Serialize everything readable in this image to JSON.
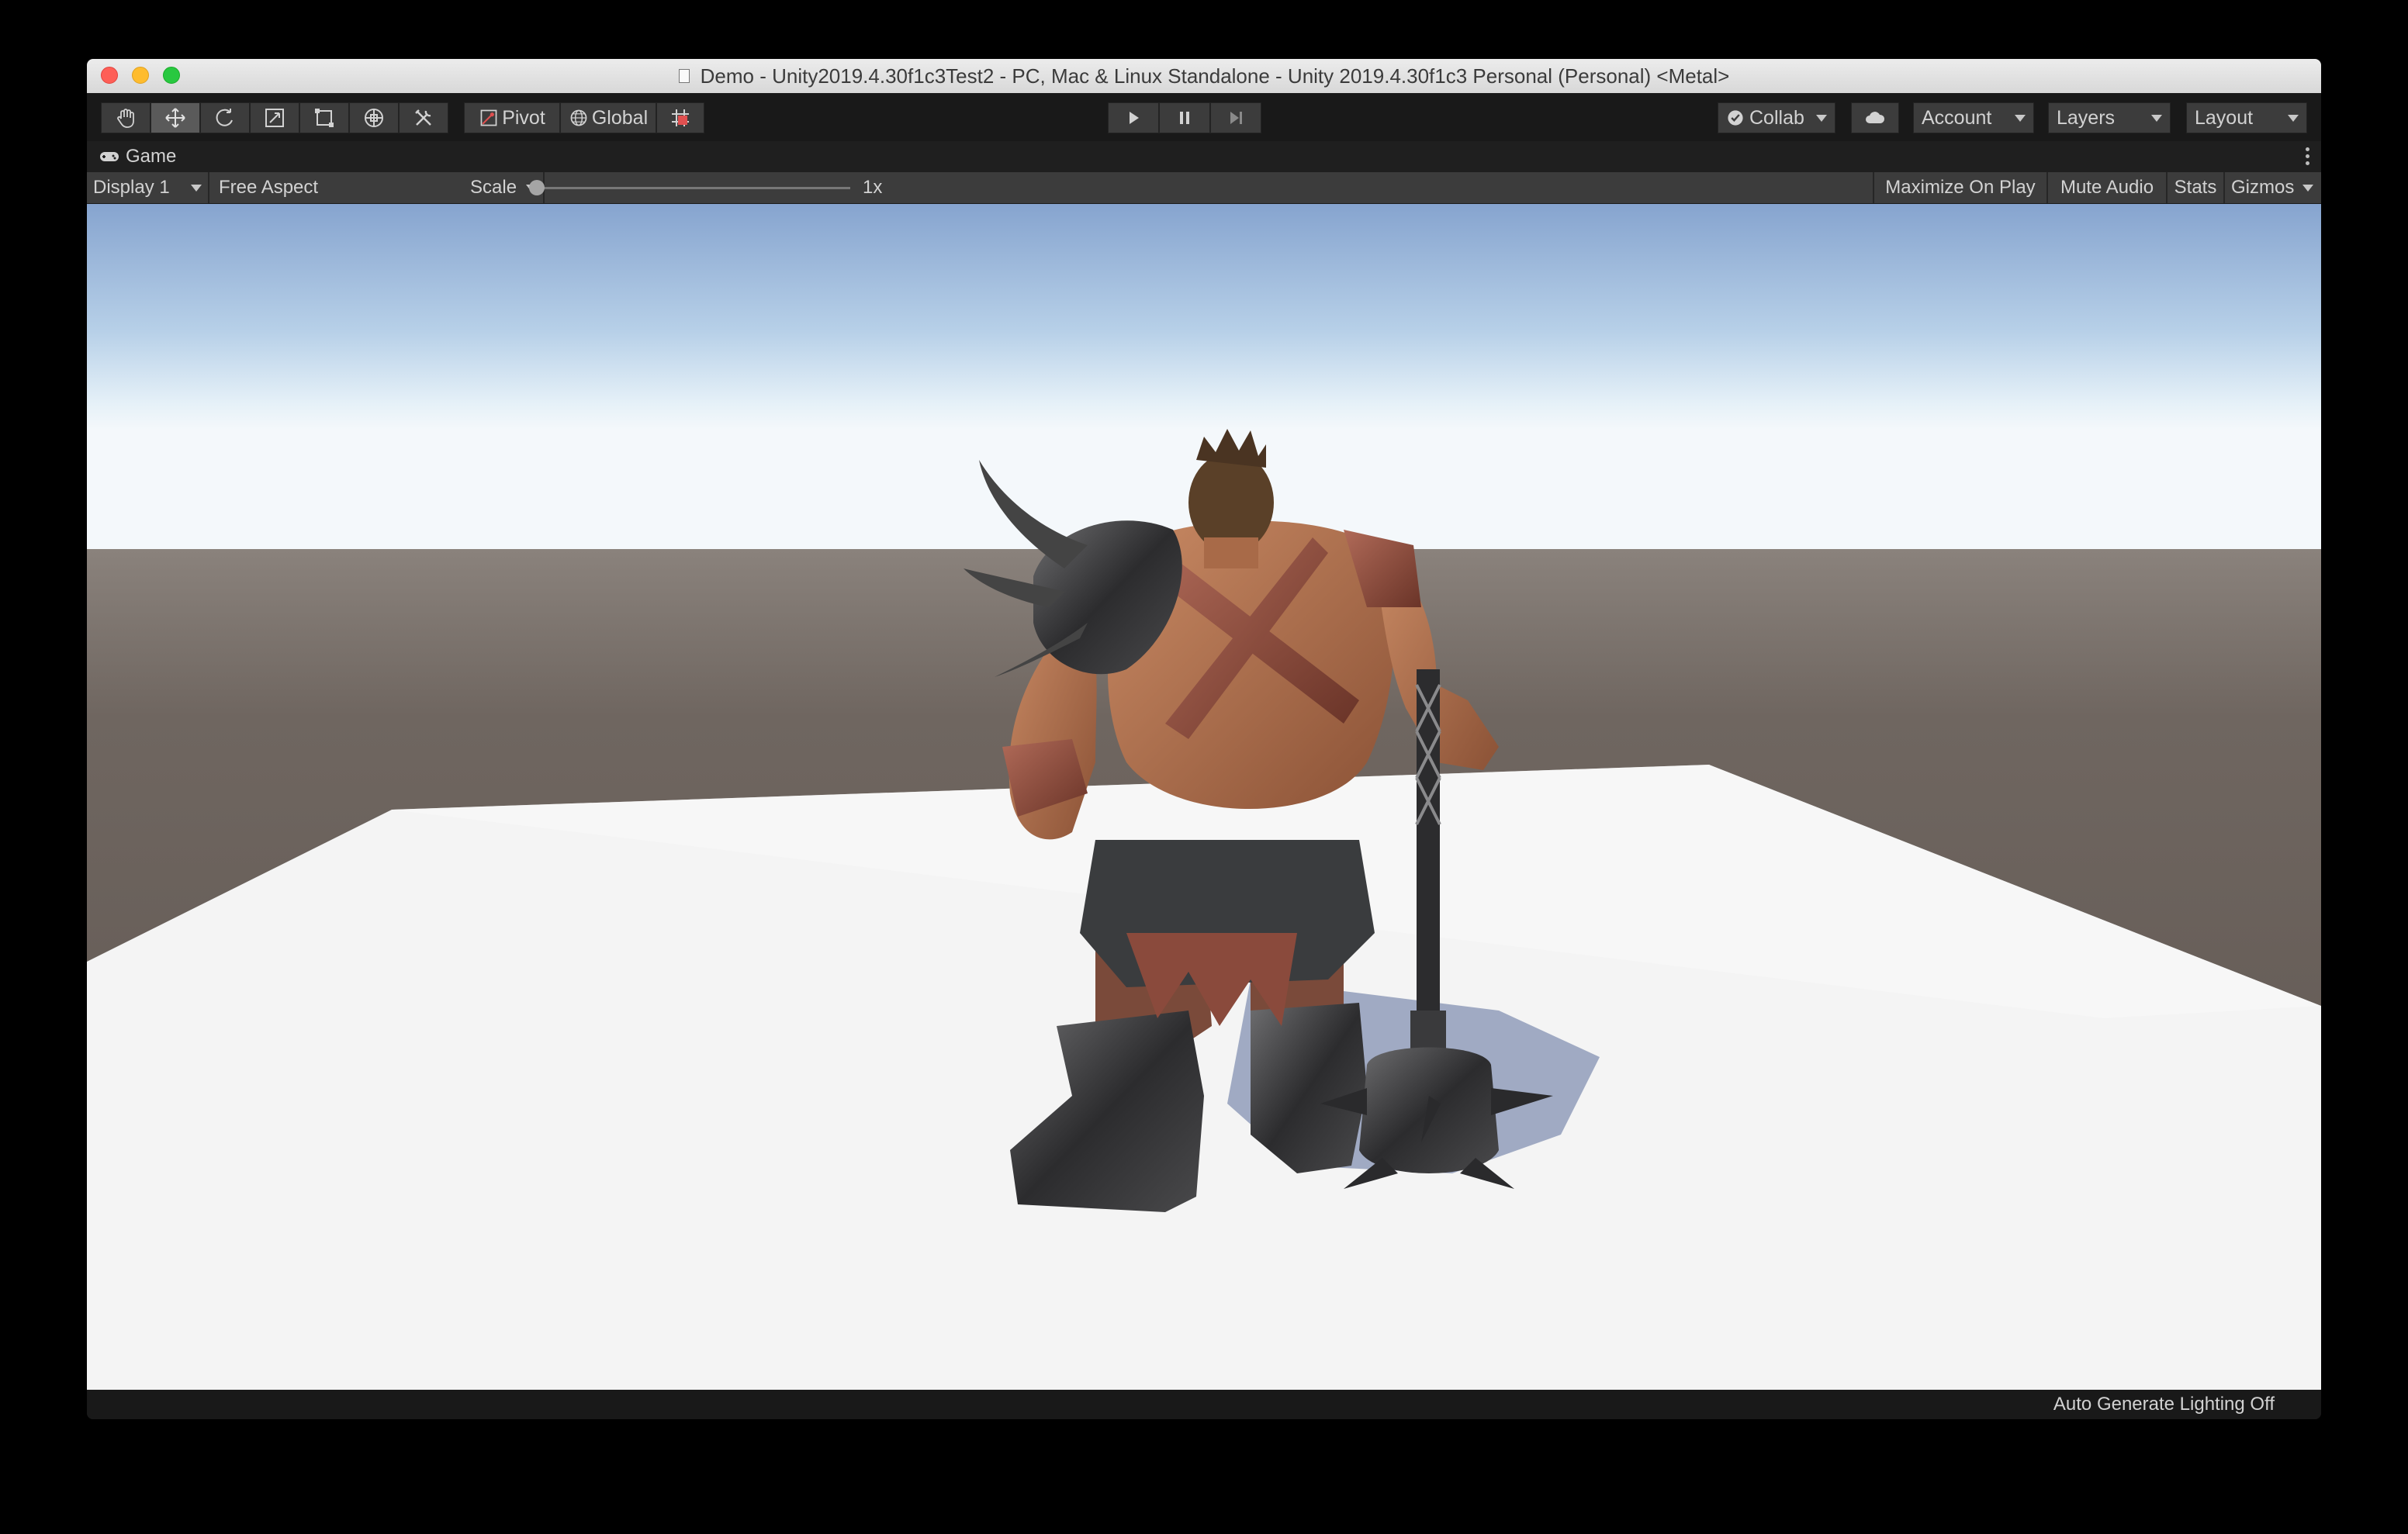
{
  "window": {
    "title": "Demo - Unity2019.4.30f1c3Test2 - PC, Mac & Linux Standalone - Unity 2019.4.30f1c3 Personal (Personal) <Metal>"
  },
  "toolbar": {
    "tools": [
      {
        "name": "hand-tool",
        "icon": "hand-icon"
      },
      {
        "name": "move-tool",
        "icon": "move-icon",
        "active": true
      },
      {
        "name": "rotate-tool",
        "icon": "rotate-icon"
      },
      {
        "name": "scale-tool",
        "icon": "scale-icon"
      },
      {
        "name": "rect-tool",
        "icon": "rect-icon"
      },
      {
        "name": "transform-tool",
        "icon": "transform-icon"
      },
      {
        "name": "custom-tool",
        "icon": "tools-icon"
      }
    ],
    "pivot_label": "Pivot",
    "global_label": "Global",
    "snap_icon": "grid-snap-icon",
    "play_icon": "play-icon",
    "pause_icon": "pause-icon",
    "step_icon": "step-icon",
    "collab_label": "Collab",
    "cloud_icon": "cloud-icon",
    "account_label": "Account",
    "layers_label": "Layers",
    "layout_label": "Layout"
  },
  "game_tab": {
    "label": "Game",
    "icon": "gamepad-icon"
  },
  "game_toolbar": {
    "display": "Display 1",
    "aspect": "Free Aspect",
    "scale_label": "Scale",
    "scale_value": "1x",
    "scale_fraction": 0.0,
    "maximize_on_play": "Maximize On Play",
    "mute_audio": "Mute Audio",
    "stats": "Stats",
    "gizmos": "Gizmos"
  },
  "statusbar": {
    "text": "Auto Generate Lighting Off"
  },
  "colors": {
    "sky_top": "#8aa9d4",
    "horizon": "#f0f6fa",
    "ground_far": "#6f6660",
    "plane": "#f4f4f4",
    "editor_dark": "#191919",
    "button": "#3c3c3c"
  }
}
